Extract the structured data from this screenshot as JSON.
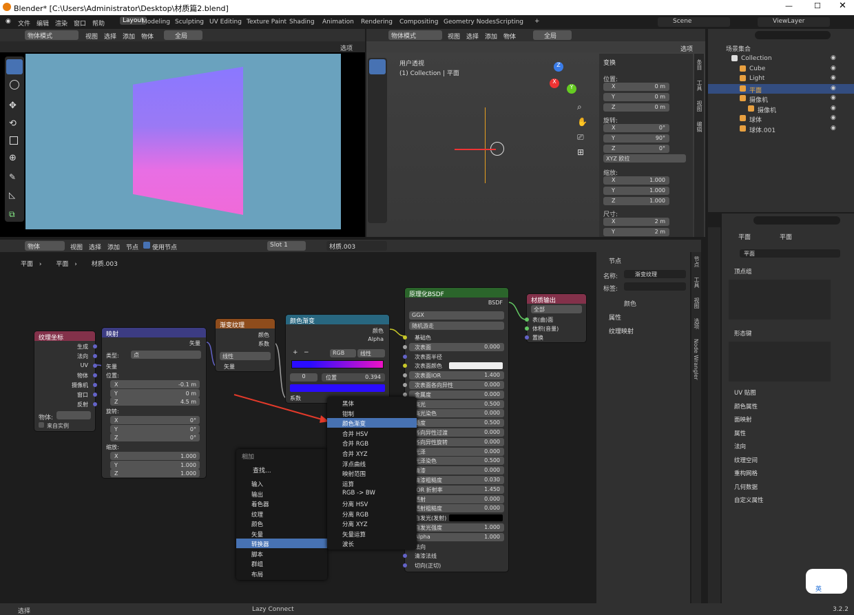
{
  "window": {
    "title": "Blender* [C:\\Users\\Administrator\\Desktop\\材质篇2.blend]"
  },
  "menus": [
    "文件",
    "编辑",
    "渲染",
    "窗口",
    "帮助"
  ],
  "workspaces": [
    "Layout",
    "Modeling",
    "Sculpting",
    "UV Editing",
    "Texture Paint",
    "Shading",
    "Animation",
    "Rendering",
    "Compositing",
    "Geometry Nodes",
    "Scripting"
  ],
  "scene": "Scene",
  "viewlayer": "ViewLayer",
  "viewport_left": {
    "mode": "物体模式",
    "menu": [
      "视图",
      "选择",
      "添加",
      "物体"
    ],
    "global": "全局",
    "select": "选项"
  },
  "viewport_right": {
    "mode": "物体模式",
    "menu": [
      "视图",
      "选择",
      "添加",
      "物体"
    ],
    "global": "全局",
    "select": "选项",
    "info1": "用户透视",
    "info2": "(1) Collection | 平面"
  },
  "transform": {
    "title": "变换",
    "loc": "位置:",
    "rot": "旋转:",
    "scale": "缩放:",
    "dim": "尺寸:",
    "loc_vals": [
      [
        "X",
        "0 m"
      ],
      [
        "Y",
        "0 m"
      ],
      [
        "Z",
        "0 m"
      ]
    ],
    "rot_vals": [
      [
        "X",
        "0°"
      ],
      [
        "Y",
        "90°"
      ],
      [
        "Z",
        "0°"
      ]
    ],
    "rot_mode": "XYZ 欧拉",
    "scale_vals": [
      [
        "X",
        "1.000"
      ],
      [
        "Y",
        "1.000"
      ],
      [
        "Z",
        "1.000"
      ]
    ],
    "dim_vals": [
      [
        "X",
        "2 m"
      ],
      [
        "Y",
        "2 m"
      ]
    ]
  },
  "npanel_tabs": [
    "条目",
    "工具",
    "视图",
    "编辑"
  ],
  "outliner": {
    "root": "场景集合",
    "items": [
      {
        "name": "Collection",
        "indent": 0
      },
      {
        "name": "Cube",
        "indent": 1
      },
      {
        "name": "Light",
        "indent": 1
      },
      {
        "name": "平面",
        "indent": 1
      },
      {
        "name": "摄像机",
        "indent": 1
      },
      {
        "name": "摄像机",
        "indent": 2
      },
      {
        "name": "球体",
        "indent": 1
      },
      {
        "name": "球体.001",
        "indent": 1
      }
    ]
  },
  "node_editor": {
    "obj": "物体",
    "menu": [
      "视图",
      "选择",
      "添加",
      "节点"
    ],
    "use_nodes": "使用节点",
    "slot": "Slot 1",
    "material": "材质.003",
    "breadcrumb": [
      "平面",
      "平面",
      "材质.003"
    ]
  },
  "nodes": {
    "texcoord": {
      "title": "纹理坐标",
      "outputs": [
        "生成",
        "法向",
        "UV",
        "物体",
        "摄像机",
        "窗口",
        "反射"
      ],
      "obj_label": "物体:",
      "from_inst": "来自实例"
    },
    "mapping": {
      "title": "映射",
      "out": "矢量",
      "type_label": "类型:",
      "type": "点",
      "vector": "矢量",
      "loc": "位置:",
      "loc_vals": [
        [
          "X",
          "-0.1 m"
        ],
        [
          "Y",
          "0 m"
        ],
        [
          "Z",
          "4.5 m"
        ]
      ],
      "rot": "旋转:",
      "rot_vals": [
        [
          "X",
          "0°"
        ],
        [
          "Y",
          "0°"
        ],
        [
          "Z",
          "0°"
        ]
      ],
      "scale": "缩放:",
      "scale_vals": [
        [
          "X",
          "1.000"
        ],
        [
          "Y",
          "1.000"
        ],
        [
          "Z",
          "1.000"
        ]
      ]
    },
    "gradient": {
      "title": "渐变纹理",
      "out1": "颜色",
      "out2": "系数",
      "type": "线性",
      "vector": "矢量"
    },
    "ramp": {
      "title": "颜色渐变",
      "out1": "颜色",
      "out2": "Alpha",
      "mode": "RGB",
      "interp": "线性",
      "idx": "0",
      "pos_label": "位置",
      "pos": "0.394",
      "fac": "系数"
    },
    "bsdf": {
      "title": "原理化BSDF",
      "out": "BSDF",
      "dist": "GGX",
      "sss": "随机游走",
      "rows": [
        [
          "基础色",
          ""
        ],
        [
          "次表面",
          "0.000"
        ],
        [
          "次表面半径",
          ""
        ],
        [
          "次表面颜色",
          ""
        ],
        [
          "次表面IOR",
          "1.400"
        ],
        [
          "次表面各向异性",
          "0.000"
        ],
        [
          "金属度",
          "0.000"
        ],
        [
          "高光",
          "0.500"
        ],
        [
          "高光染色",
          "0.000"
        ],
        [
          "糙度",
          "0.500"
        ],
        [
          "各向异性过渡",
          "0.000"
        ],
        [
          "各向异性旋转",
          "0.000"
        ],
        [
          "光泽",
          "0.000"
        ],
        [
          "光泽染色",
          "0.500"
        ],
        [
          "清漆",
          "0.000"
        ],
        [
          "清漆粗糙度",
          "0.030"
        ],
        [
          "IOR 折射率",
          "1.450"
        ],
        [
          "透射",
          "0.000"
        ],
        [
          "透射粗糙度",
          "0.000"
        ],
        [
          "自发光(发射)",
          ""
        ],
        [
          "自发光强度",
          "1.000"
        ],
        [
          "Alpha",
          "1.000"
        ],
        [
          "法向",
          ""
        ],
        [
          "清漆法线",
          ""
        ],
        [
          "切向(正切)",
          ""
        ]
      ]
    },
    "output": {
      "title": "材质输出",
      "target": "全部",
      "inputs": [
        "表(曲)面",
        "体积(音量)",
        "置换"
      ]
    }
  },
  "add_menu": {
    "title": "相加",
    "search": "查找...",
    "items": [
      "输入",
      "输出",
      "着色器",
      "纹理",
      "颜色",
      "矢量",
      "转换器",
      "脚本",
      "群组",
      "布局"
    ],
    "selected": "转换器"
  },
  "converter_menu": {
    "items": [
      "黑体",
      "钳制",
      "颜色渐变",
      "合并 HSV",
      "合并 RGB",
      "合并 XYZ",
      "浮点曲线",
      "映射范围",
      "运算",
      "RGB -> BW",
      "分离 HSV",
      "分离 RGB",
      "分离 XYZ",
      "矢量运算",
      "波长"
    ],
    "selected": "颜色渐变"
  },
  "node_panel": {
    "title": "节点",
    "name_label": "名称:",
    "name": "渐变纹理",
    "label_label": "标签:",
    "color": "颜色",
    "props": "属性",
    "texmap": "纹理映射"
  },
  "node_tabs": [
    "节点",
    "工具",
    "视图",
    "选项",
    "Node Wrangler"
  ],
  "props": {
    "obj": "平面",
    "mesh": "平面",
    "data": "平面",
    "sections": [
      "顶点组",
      "形态键",
      "UV 贴图",
      "颜色属性",
      "面映射",
      "属性",
      "法向",
      "纹理空间",
      "重构网格",
      "几何数据",
      "自定义属性"
    ]
  },
  "status": {
    "left": "选择",
    "mid": "Lazy Connect",
    "version": "3.2.2"
  },
  "ime": "英"
}
